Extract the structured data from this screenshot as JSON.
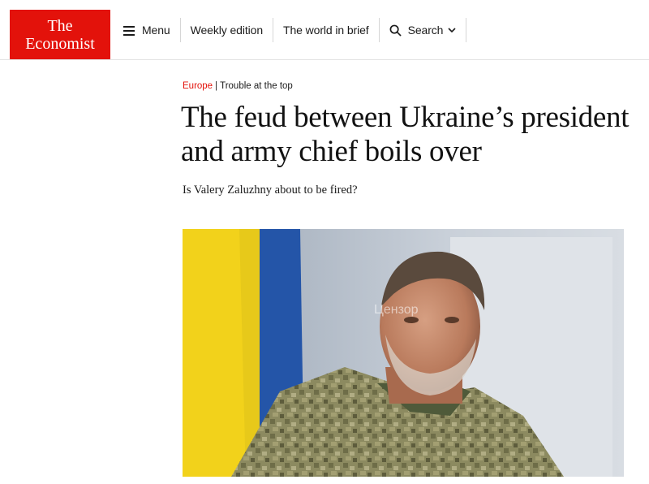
{
  "brand": {
    "line1": "The",
    "line2": "Economist",
    "color": "#e3120b"
  },
  "nav": {
    "menu_label": "Menu",
    "menu_icon": "hamburger-icon",
    "weekly_label": "Weekly edition",
    "world_label": "The world in brief",
    "search_label": "Search",
    "search_icon": "search-icon",
    "search_chevron": "chevron-down-icon"
  },
  "article": {
    "section": "Europe",
    "separator": "|",
    "rubric": "Trouble at the top",
    "headline": "The feud between Ukraine’s president and army chief boils over",
    "standfirst": "Is Valery Zaluzhny about to be fired?",
    "image": {
      "subject": "portrait-photo",
      "watermark": "Цензор"
    }
  },
  "colors": {
    "accent": "#e3120b",
    "flag_yellow": "#f2d21b",
    "flag_blue": "#2455a8"
  }
}
